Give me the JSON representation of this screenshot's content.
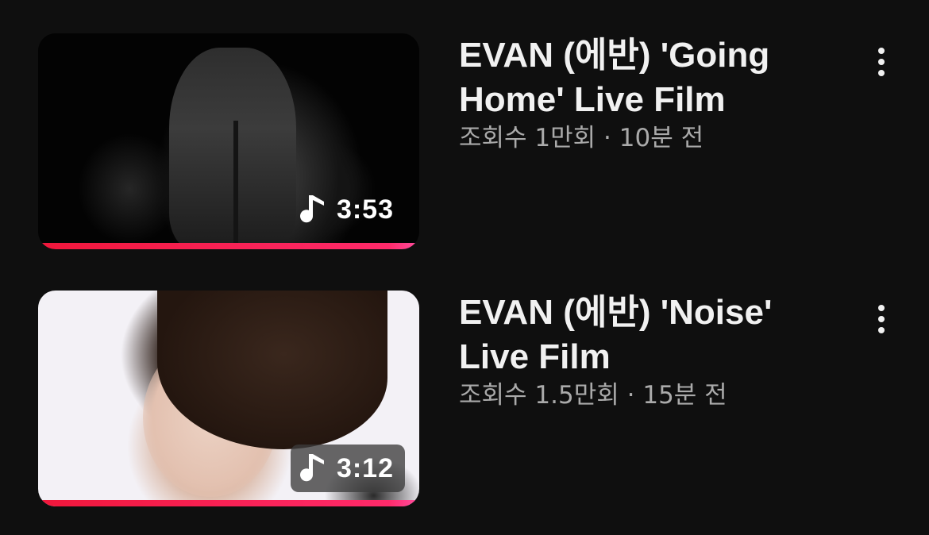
{
  "videos": [
    {
      "title": "EVAN (에반) 'Going Home' Live Film",
      "views": "조회수 1만회",
      "separator": "·",
      "age": "10분 전",
      "duration": "3:53",
      "duration_icon": "music-note-icon",
      "progress_percent": 100,
      "menu_icon": "more-vert-icon"
    },
    {
      "title": "EVAN (에반) 'Noise' Live Film",
      "views": "조회수 1.5만회",
      "separator": "·",
      "age": "15분 전",
      "duration": "3:12",
      "duration_icon": "music-note-icon",
      "progress_percent": 100,
      "menu_icon": "more-vert-icon"
    }
  ],
  "colors": {
    "background": "#0f0f0f",
    "title": "#f1f1f1",
    "meta": "#aaaaaa",
    "progress": "#f0173b"
  }
}
